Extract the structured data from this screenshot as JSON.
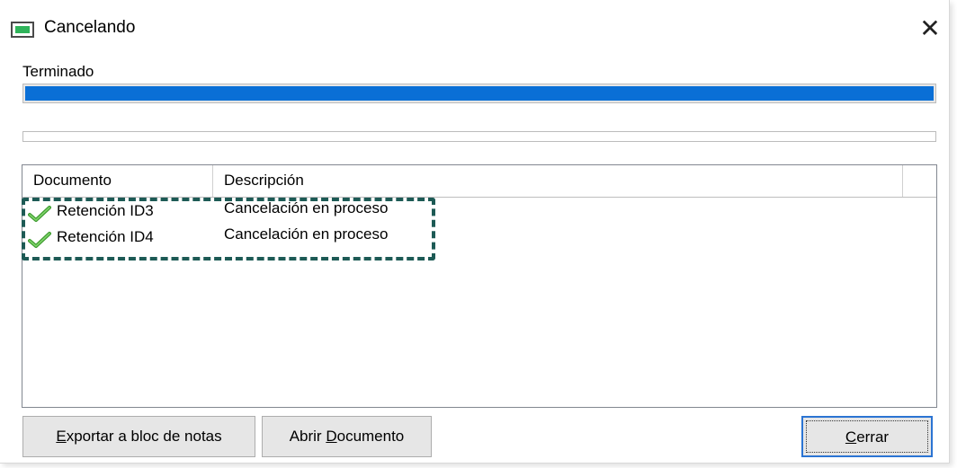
{
  "window": {
    "title": "Cancelando",
    "close_glyph": "✕"
  },
  "status": {
    "label": "Terminado",
    "main_progress": 1.0,
    "secondary_progress": 0.0
  },
  "list": {
    "columns": [
      "Documento",
      "Descripción",
      ""
    ],
    "rows": [
      {
        "icon": "check-icon",
        "documento": "Retención ID3",
        "descripcion": "Cancelación en proceso"
      },
      {
        "icon": "check-icon",
        "documento": "Retención ID4",
        "descripcion": "Cancelación en proceso"
      }
    ]
  },
  "buttons": {
    "export": {
      "pre": "",
      "mnemonic": "E",
      "post": "xportar a bloc de notas"
    },
    "open": {
      "pre": "Abrir ",
      "mnemonic": "D",
      "post": "ocumento"
    },
    "close": {
      "pre": "",
      "mnemonic": "C",
      "post": "errar"
    }
  },
  "colors": {
    "accent": "#0a6fd6",
    "highlight_border": "#1d5a55",
    "check_green": "#4caf3a"
  }
}
